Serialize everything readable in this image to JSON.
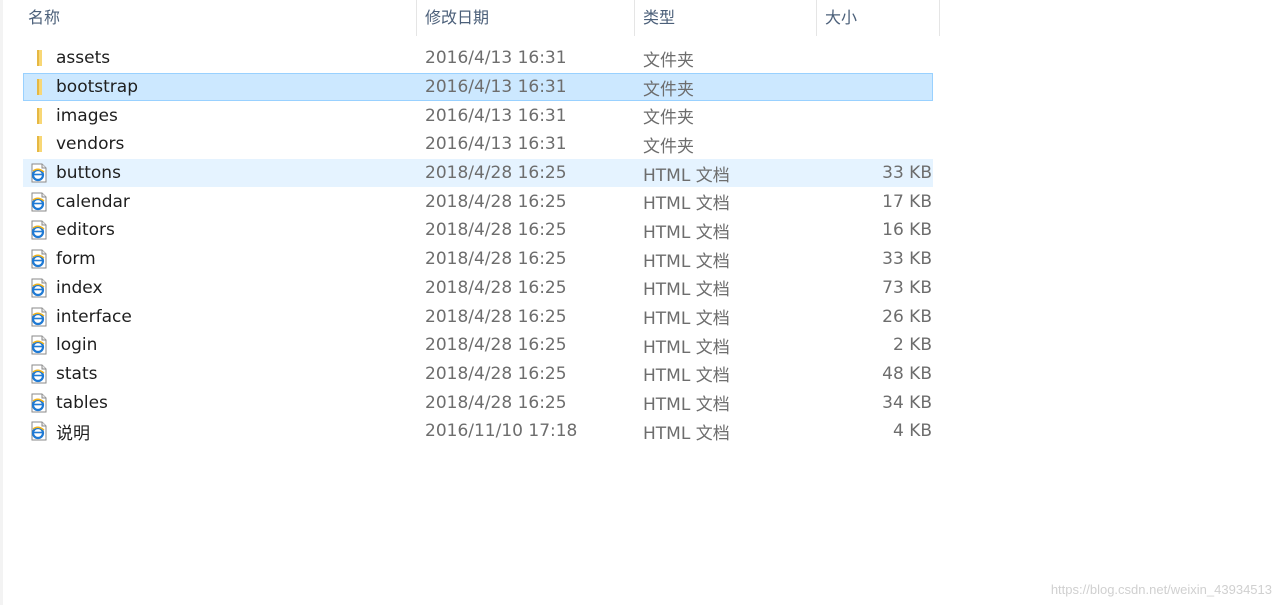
{
  "header": {
    "name": "名称",
    "date": "修改日期",
    "type": "类型",
    "size": "大小",
    "sort_glyph": "^"
  },
  "rows": [
    {
      "name": "assets",
      "date": "2016/4/13 16:31",
      "type": "文件夹",
      "size": "",
      "icon": "folder-icon"
    },
    {
      "name": "bootstrap",
      "date": "2016/4/13 16:31",
      "type": "文件夹",
      "size": "",
      "icon": "folder-icon",
      "state": "selected"
    },
    {
      "name": "images",
      "date": "2016/4/13 16:31",
      "type": "文件夹",
      "size": "",
      "icon": "folder-icon"
    },
    {
      "name": "vendors",
      "date": "2016/4/13 16:31",
      "type": "文件夹",
      "size": "",
      "icon": "folder-icon"
    },
    {
      "name": "buttons",
      "date": "2018/4/28 16:25",
      "type": "HTML 文档",
      "size": "33 KB",
      "icon": "html-file-icon",
      "state": "hover"
    },
    {
      "name": "calendar",
      "date": "2018/4/28 16:25",
      "type": "HTML 文档",
      "size": "17 KB",
      "icon": "html-file-icon"
    },
    {
      "name": "editors",
      "date": "2018/4/28 16:25",
      "type": "HTML 文档",
      "size": "16 KB",
      "icon": "html-file-icon"
    },
    {
      "name": "form",
      "date": "2018/4/28 16:25",
      "type": "HTML 文档",
      "size": "33 KB",
      "icon": "html-file-icon"
    },
    {
      "name": "index",
      "date": "2018/4/28 16:25",
      "type": "HTML 文档",
      "size": "73 KB",
      "icon": "html-file-icon"
    },
    {
      "name": "interface",
      "date": "2018/4/28 16:25",
      "type": "HTML 文档",
      "size": "26 KB",
      "icon": "html-file-icon"
    },
    {
      "name": "login",
      "date": "2018/4/28 16:25",
      "type": "HTML 文档",
      "size": "2 KB",
      "icon": "html-file-icon"
    },
    {
      "name": "stats",
      "date": "2018/4/28 16:25",
      "type": "HTML 文档",
      "size": "48 KB",
      "icon": "html-file-icon"
    },
    {
      "name": "tables",
      "date": "2018/4/28 16:25",
      "type": "HTML 文档",
      "size": "34 KB",
      "icon": "html-file-icon"
    },
    {
      "name": "说明",
      "date": "2016/11/10 17:18",
      "type": "HTML 文档",
      "size": "4 KB",
      "icon": "html-file-icon"
    }
  ],
  "colors": {
    "selected_bg": "#cce8ff",
    "selected_border": "#99d1ff",
    "hover_bg": "#e5f3ff",
    "folder": "#f8d775",
    "html_icon_accent": "#1f7ad4"
  },
  "watermark": "https://blog.csdn.net/weixin_43934513"
}
